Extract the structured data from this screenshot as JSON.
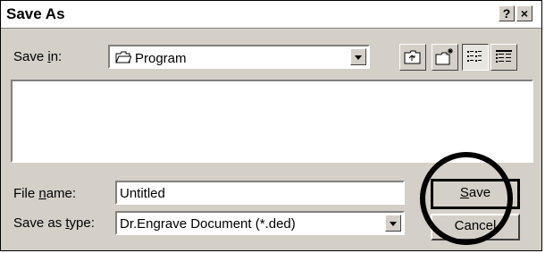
{
  "window": {
    "title": "Save As",
    "help_btn": "?",
    "close_btn": "×"
  },
  "save_in": {
    "label_pre": "Save ",
    "label_u": "i",
    "label_post": "n:",
    "value": "Program"
  },
  "toolbar": {
    "up_icon": "up-one-level-icon",
    "new_folder_icon": "new-folder-icon",
    "list_icon": "list-view-icon",
    "details_icon": "details-view-icon"
  },
  "file_name": {
    "label_pre": "File ",
    "label_u": "n",
    "label_post": "ame:",
    "value": "Untitled"
  },
  "save_type": {
    "label_pre": "Save as ",
    "label_u": "t",
    "label_post": "ype:",
    "value": "Dr.Engrave Document (*.ded)"
  },
  "buttons": {
    "save_u": "S",
    "save_rest": "ave",
    "cancel": "Cancel"
  },
  "colors": {
    "dialog_bg": "#d4d0c8",
    "highlight_circle": "#000000"
  }
}
